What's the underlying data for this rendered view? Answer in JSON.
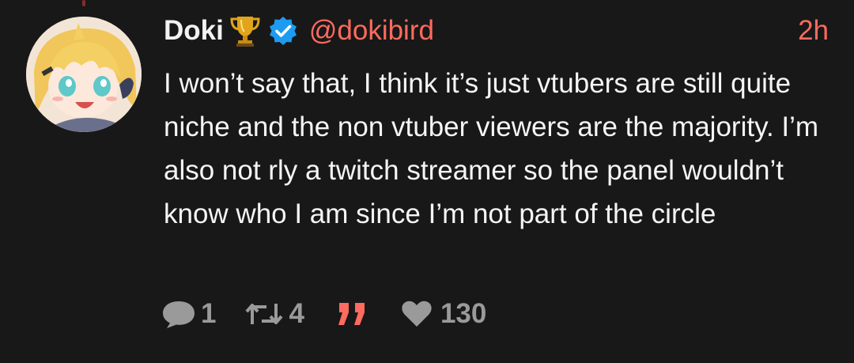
{
  "tweet": {
    "display_name": "Doki",
    "handle": "@dokibird",
    "timestamp": "2h",
    "badges": [
      "trophy-icon",
      "verified-icon"
    ],
    "text": "I won’t say that, I think it’s just vtubers are still quite niche and the non vtuber viewers are the majority. I’m also not rly a twitch streamer so the panel wouldn’t know who I am since I’m not part of the circle",
    "actions": {
      "reply_count": "1",
      "retweet_count": "4",
      "like_count": "130"
    }
  },
  "colors": {
    "background": "#181818",
    "accent": "#ff6b5e",
    "verified": "#1d9bf0",
    "muted": "#9a9a9a",
    "text": "#f5f5f5"
  }
}
